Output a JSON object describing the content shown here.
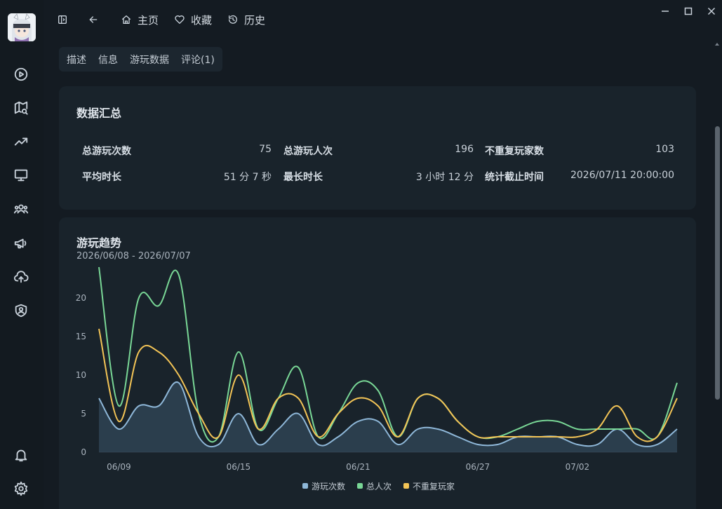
{
  "titlebar": {
    "home_label": "主页",
    "favorites_label": "收藏",
    "history_label": "历史"
  },
  "tabs": [
    {
      "label": "描述"
    },
    {
      "label": "信息"
    },
    {
      "label": "游玩数据"
    },
    {
      "label": "评论(1)"
    }
  ],
  "summary": {
    "title": "数据汇总",
    "stats": [
      {
        "label": "总游玩次数",
        "value": "75"
      },
      {
        "label": "总游玩人次",
        "value": "196"
      },
      {
        "label": "不重复玩家数",
        "value": "103"
      },
      {
        "label": "平均时长",
        "value": "51 分 7 秒"
      },
      {
        "label": "最长时长",
        "value": "3 小时 12 分"
      },
      {
        "label": "统计截止时间",
        "value": "2026/07/11 20:00:00"
      }
    ]
  },
  "trend": {
    "title": "游玩趋势",
    "range": "2026/06/08 - 2026/07/07"
  },
  "chart_data": {
    "type": "area",
    "x": [
      "06/08",
      "06/09",
      "06/10",
      "06/11",
      "06/12",
      "06/13",
      "06/14",
      "06/15",
      "06/16",
      "06/17",
      "06/18",
      "06/19",
      "06/20",
      "06/21",
      "06/22",
      "06/23",
      "06/24",
      "06/25",
      "06/26",
      "06/27",
      "06/28",
      "06/29",
      "06/30",
      "07/01",
      "07/02",
      "07/03",
      "07/04",
      "07/05",
      "07/06",
      "07/07"
    ],
    "xticks": [
      "06/09",
      "06/15",
      "06/21",
      "06/27",
      "07/02"
    ],
    "yticks": [
      0,
      5,
      10,
      15,
      20
    ],
    "ylim": [
      0,
      24
    ],
    "legend_position": "bottom",
    "series": [
      {
        "name": "游玩次数",
        "color": "#8fb8d9",
        "values": [
          7,
          3,
          6,
          6,
          9,
          2,
          1,
          5,
          1,
          3,
          5,
          1,
          2,
          4,
          4,
          1,
          3,
          3,
          2,
          1,
          1,
          2,
          2,
          2,
          1,
          1,
          3,
          1,
          1,
          3
        ]
      },
      {
        "name": "总人次",
        "color": "#79d796",
        "values": [
          24,
          6,
          20,
          19,
          23,
          5,
          2,
          13,
          3,
          7,
          11,
          2,
          5,
          9,
          8,
          2,
          7,
          7,
          4,
          2,
          2,
          3,
          4,
          4,
          3,
          3,
          3,
          3,
          2,
          9
        ]
      },
      {
        "name": "不重复玩家",
        "color": "#f3c456",
        "values": [
          16,
          4,
          13,
          13,
          10,
          5,
          2,
          10,
          3,
          7,
          7,
          2,
          5,
          7,
          6,
          2,
          7,
          7,
          4,
          2,
          2,
          2,
          2,
          2,
          2,
          3,
          6,
          2,
          2,
          7
        ]
      }
    ]
  }
}
